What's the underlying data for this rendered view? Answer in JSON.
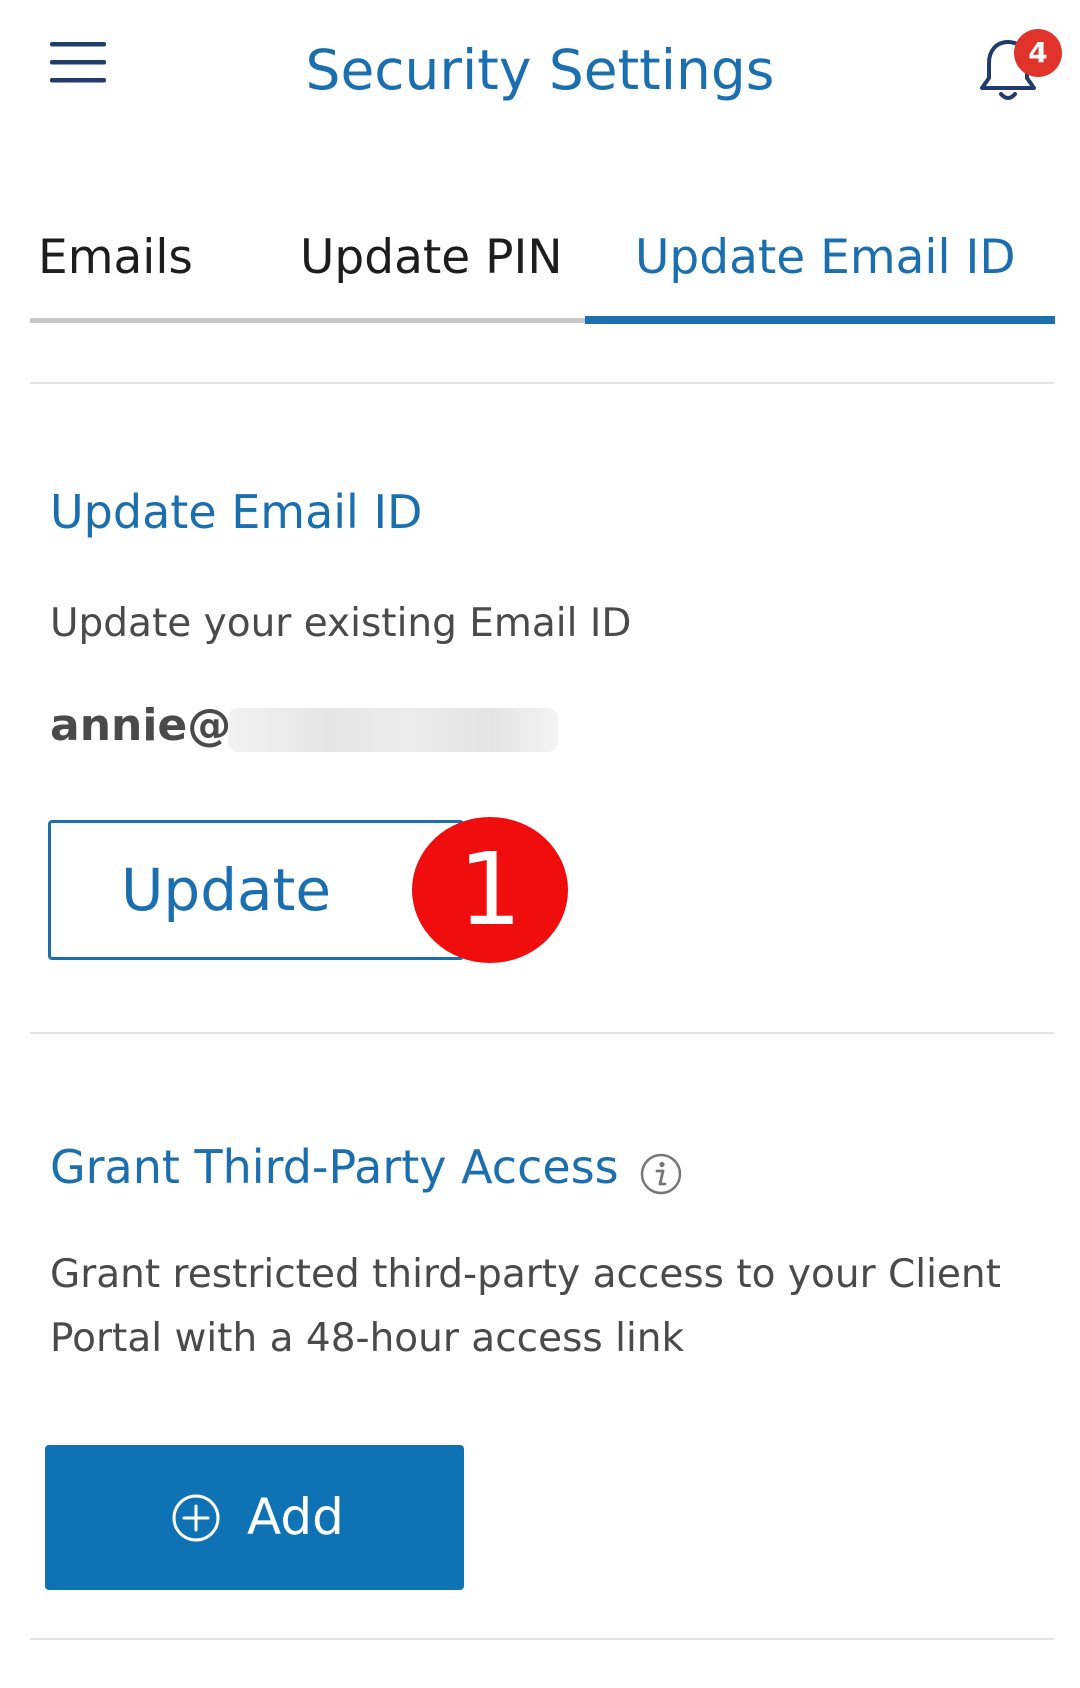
{
  "header": {
    "title": "Security Settings",
    "menu_icon": "hamburger-menu-icon",
    "notification_icon": "bell-icon",
    "notification_count": "4"
  },
  "tabs": [
    {
      "label": "Emails",
      "active": false
    },
    {
      "label": "Update PIN",
      "active": false
    },
    {
      "label": "Update Email ID",
      "active": true
    }
  ],
  "update_email": {
    "heading": "Update Email ID",
    "description": "Update your existing Email ID",
    "email_visible": "annie@",
    "button_label": "Update",
    "step_marker": "1"
  },
  "third_party": {
    "heading": "Grant Third-Party Access",
    "info_icon": "info-icon",
    "description": "Grant restricted third-party access to your Client Portal with a 48-hour access link",
    "button_label": "Add",
    "button_icon": "plus-circle-icon"
  },
  "colors": {
    "accent": "#1b6fae",
    "primary_button": "#0e72b5",
    "badge": "#e0342b",
    "step_marker": "#ef0d0d",
    "text": "#4a4a4a"
  }
}
